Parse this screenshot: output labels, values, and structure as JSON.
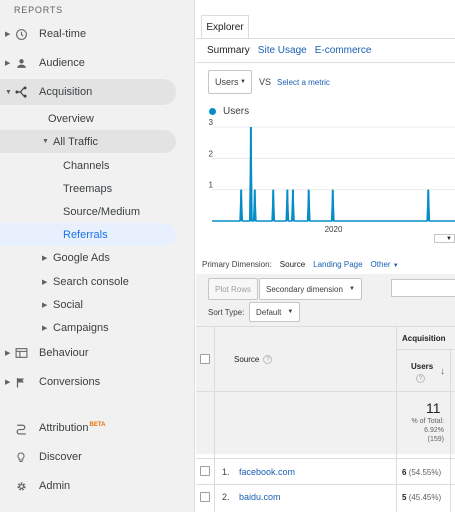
{
  "sidebar": {
    "section_header": "REPORTS",
    "items": [
      {
        "label": "Real-time",
        "icon": "clock-icon"
      },
      {
        "label": "Audience",
        "icon": "person-icon"
      },
      {
        "label": "Acquisition",
        "icon": "acquisition-icon"
      }
    ],
    "acquisition_sub": {
      "overview": "Overview",
      "all_traffic": "All Traffic",
      "channels": "Channels",
      "treemaps": "Treemaps",
      "source_medium": "Source/Medium",
      "referrals": "Referrals",
      "google_ads": "Google Ads",
      "search_console": "Search console",
      "social": "Social",
      "campaigns": "Campaigns"
    },
    "behaviour": "Behaviour",
    "conversions": "Conversions",
    "attribution": "Attribution",
    "attribution_badge": "BETA",
    "discover": "Discover",
    "admin": "Admin"
  },
  "main": {
    "tab": "Explorer",
    "subtabs": [
      "Summary",
      "Site Usage",
      "E-commerce"
    ],
    "metric_select": "Users",
    "vs": "VS",
    "select_metric": "Select a metric",
    "legend_label": "Users",
    "legend_color": "#058dc7",
    "primary_dimension_label": "Primary Dimension:",
    "primary_dimension_value": "Source",
    "landing_page": "Landing Page",
    "other": "Other",
    "plot_rows": "Plot Rows",
    "secondary_dimension": "Secondary dimension",
    "sort_type_label": "Sort Type:",
    "sort_type_value": "Default"
  },
  "chart_data": {
    "type": "line",
    "series": [
      {
        "name": "Users",
        "color": "#058dc7"
      }
    ],
    "y_ticks": [
      "3",
      "2",
      "1"
    ],
    "x_label": "2020",
    "ylim": [
      0,
      3
    ],
    "spikes": [
      {
        "pos": 0.12,
        "value": 1
      },
      {
        "pos": 0.16,
        "value": 3
      },
      {
        "pos": 0.176,
        "value": 1
      },
      {
        "pos": 0.252,
        "value": 1
      },
      {
        "pos": 0.31,
        "value": 1
      },
      {
        "pos": 0.333,
        "value": 1
      },
      {
        "pos": 0.398,
        "value": 1
      },
      {
        "pos": 0.497,
        "value": 1
      },
      {
        "pos": 0.89,
        "value": 1
      }
    ]
  },
  "table": {
    "group_header": "Acquisition",
    "source_header": "Source",
    "users_header": "Users",
    "totals": {
      "value": "11",
      "pct_line1": "% of Total:",
      "pct_line2": "6.92%",
      "pct_line3": "(159)"
    },
    "rows": [
      {
        "num": "1.",
        "source": "facebook.com",
        "users": "6",
        "pct": "(54.55%)"
      },
      {
        "num": "2.",
        "source": "baidu.com",
        "users": "5",
        "pct": "(45.45%)"
      }
    ]
  }
}
